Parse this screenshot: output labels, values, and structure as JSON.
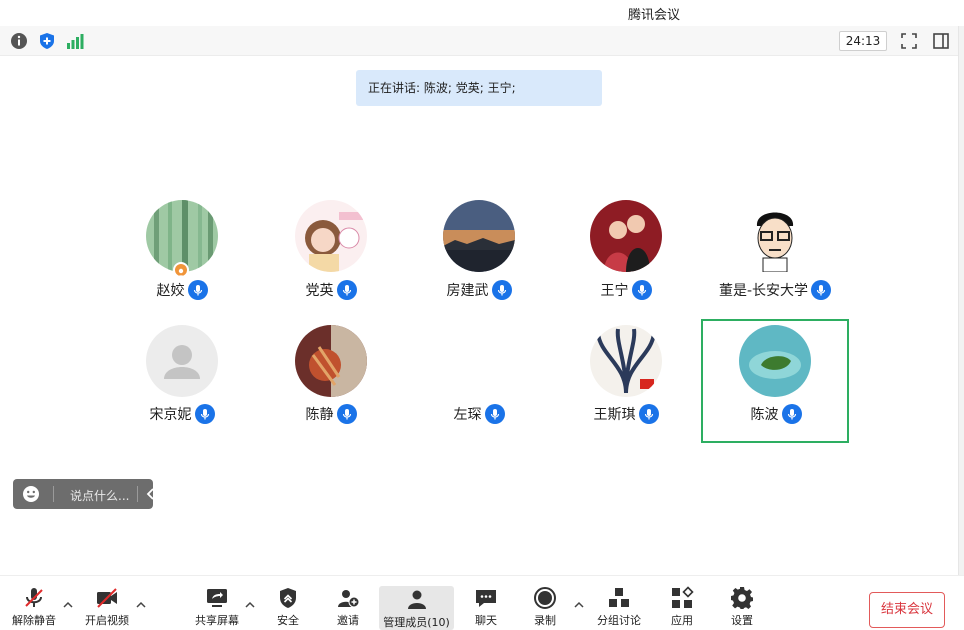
{
  "window": {
    "title": "腾讯会议"
  },
  "infobar": {
    "timer": "24:13"
  },
  "speaking": {
    "text": "正在讲话: 陈波; 党英; 王宁;"
  },
  "participants": [
    {
      "name": "赵姣",
      "host": true
    },
    {
      "name": "党英"
    },
    {
      "name": "房建武"
    },
    {
      "name": "王宁"
    },
    {
      "name": "董是-长安大学"
    },
    {
      "name": "宋京妮"
    },
    {
      "name": "陈静"
    },
    {
      "name": "左琛"
    },
    {
      "name": "王斯琪"
    },
    {
      "name": "陈波",
      "active": true
    }
  ],
  "chat": {
    "placeholder": "说点什么..."
  },
  "toolbar": {
    "unmute": "解除静音",
    "video": "开启视频",
    "share": "共享屏幕",
    "security": "安全",
    "invite": "邀请",
    "members": "管理成员(10)",
    "chat": "聊天",
    "record": "录制",
    "breakout": "分组讨论",
    "apps": "应用",
    "settings": "设置",
    "end": "结束会议"
  },
  "colors": {
    "accent": "#1a73e8",
    "active_border": "#2dae61",
    "end": "#d9363e",
    "speaking_bg": "#d9e9fb"
  }
}
